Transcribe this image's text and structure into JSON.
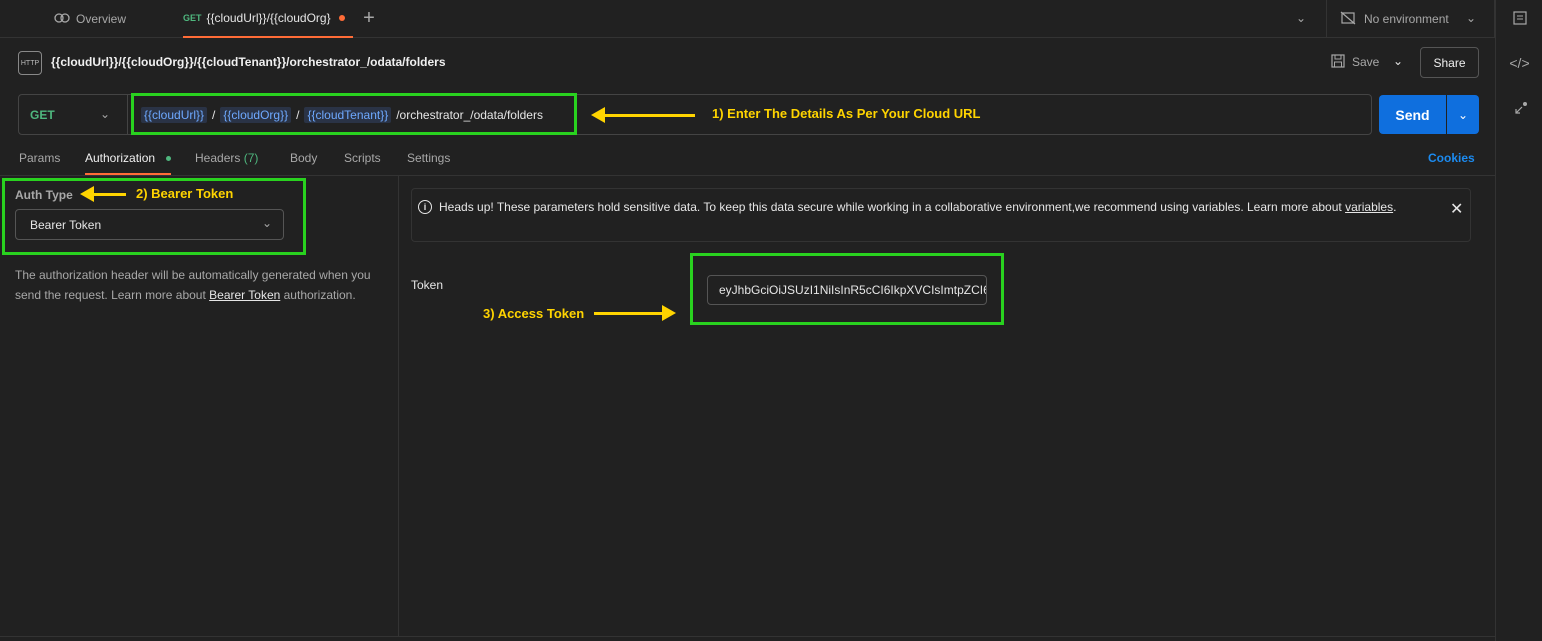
{
  "tabs": {
    "overview_label": "Overview",
    "active_method": "GET",
    "active_label": "{{cloudUrl}}/{{cloudOrg}",
    "add_label": "+"
  },
  "environment": {
    "label": "No environment"
  },
  "request": {
    "title": "{{cloudUrl}}/{{cloudOrg}}/{{cloudTenant}}/orchestrator_/odata/folders",
    "icon_label": "HTTP",
    "save_label": "Save",
    "share_label": "Share",
    "method": "GET",
    "url_parts": {
      "var1": "{{cloudUrl}}",
      "sep1": "/",
      "var2": "{{cloudOrg}}",
      "sep2": "/",
      "var3": "{{cloudTenant}}",
      "path": "/orchestrator_/odata/folders"
    },
    "send_label": "Send"
  },
  "subtabs": {
    "params": "Params",
    "authorization": "Authorization",
    "headers": "Headers",
    "headers_count": "(7)",
    "body": "Body",
    "scripts": "Scripts",
    "settings": "Settings",
    "cookies": "Cookies"
  },
  "auth": {
    "type_label": "Auth Type",
    "type_value": "Bearer Token",
    "desc_prefix": "The authorization header will be automatically generated when you send the request. Learn more about ",
    "desc_link": "Bearer Token",
    "desc_suffix": " authorization."
  },
  "info": {
    "text": "Heads up! These parameters hold sensitive data. To keep this data secure while working in a collaborative environment,we recommend using variables. Learn more about ",
    "link": "variables",
    "suffix": "."
  },
  "token": {
    "label": "Token",
    "value": "eyJhbGciOiJSUzI1NiIsInR5cCI6IkpXVCIsImtpZCI6..."
  },
  "annotations": {
    "step1": "1) Enter The Details As Per Your Cloud URL",
    "step2": "2) Bearer Token",
    "step3": "3) Access Token"
  },
  "icons": {
    "overview": "overview-icon",
    "no_env": "no-environment-icon",
    "save": "save-icon",
    "info": "info-icon",
    "close": "close-icon",
    "code": "code-icon"
  },
  "colors": {
    "accent": "#ff6c37",
    "send": "#0f6fde",
    "get": "#4fb77e",
    "highlight": "#29d21f",
    "annotation": "#ffd400"
  }
}
